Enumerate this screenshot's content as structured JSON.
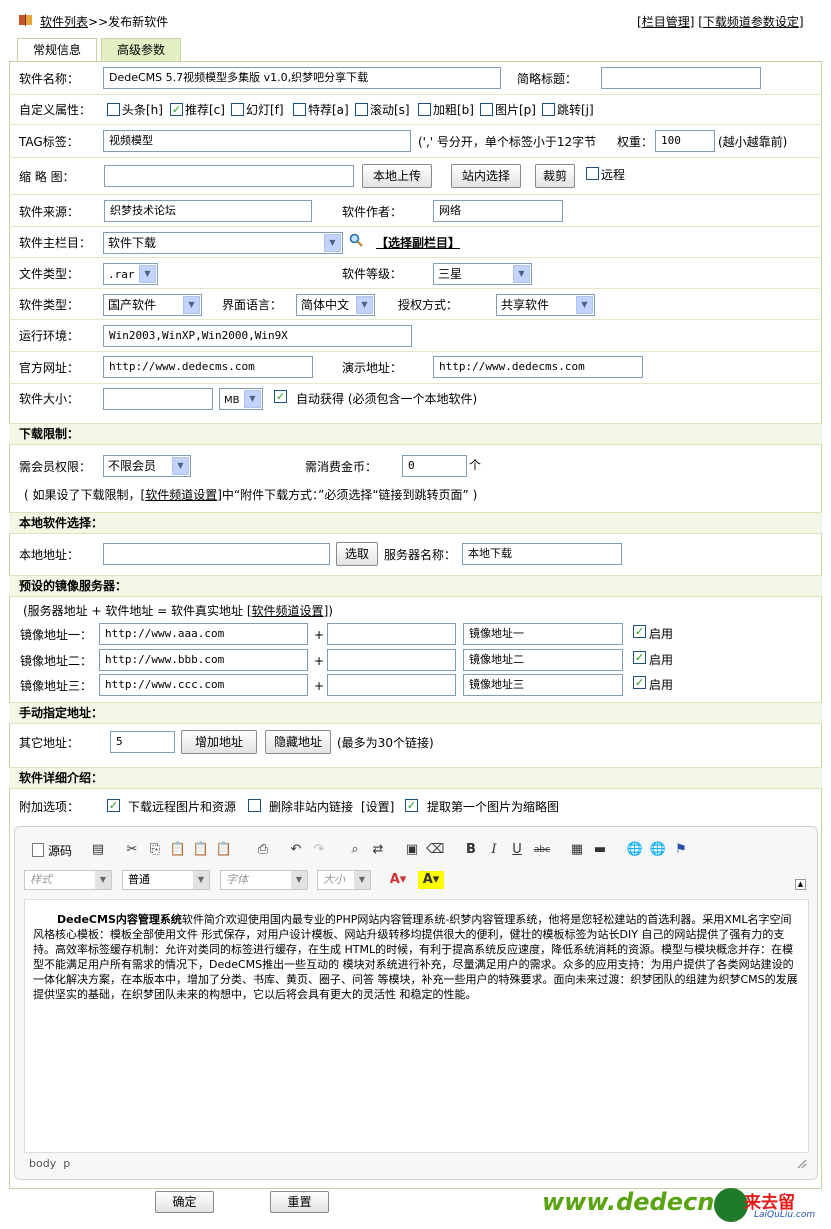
{
  "header": {
    "crumb_list": "软件列表",
    "crumb_sep": ">>",
    "crumb_current": "发布新软件",
    "link_column": "栏目管理",
    "link_params": "下载频道参数设定",
    "bracket_l": "[",
    "bracket_m": "] [",
    "bracket_r": "]"
  },
  "tabs": [
    {
      "label": "常规信息"
    },
    {
      "label": "高级参数"
    }
  ],
  "fields": {
    "title_label": "软件名称：",
    "title_value": "DedeCMS 5.7视频模型多集版 v1.0,织梦吧分享下载",
    "short_label": "简略标题：",
    "attr_label": "自定义属性：",
    "attrs": [
      {
        "label": "头条[h]",
        "checked": false
      },
      {
        "label": "推荐[c]",
        "checked": true
      },
      {
        "label": "幻灯[f]",
        "checked": false
      },
      {
        "label": "特荐[a]",
        "checked": false
      },
      {
        "label": "滚动[s]",
        "checked": false
      },
      {
        "label": "加粗[b]",
        "checked": false
      },
      {
        "label": "图片[p]",
        "checked": false
      },
      {
        "label": "跳转[j]",
        "checked": false
      }
    ],
    "tag_label": "TAG标签：",
    "tag_value": "视频模型",
    "tag_hint": "(',' 号分开，单个标签小于12字节",
    "weight_label": "权重：",
    "weight_value": "100",
    "weight_hint": "(越小越靠前)",
    "thumb_label": "缩 略 图：",
    "btn_upload": "本地上传",
    "btn_site": "站内选择",
    "btn_crop": "裁剪",
    "remote_label": "远程",
    "source_label": "软件来源：",
    "source_value": "织梦技术论坛",
    "author_label": "软件作者：",
    "author_value": "网络",
    "column_label": "软件主栏目：",
    "column_value": "软件下载",
    "sub_column": "【选择副栏目】",
    "filetype_label": "文件类型：",
    "filetype_value": ".rar",
    "level_label": "软件等级：",
    "level_value": "三星",
    "softtype_label": "软件类型：",
    "softtype_value": "国产软件",
    "lang_label": "界面语言：",
    "lang_value": "简体中文",
    "license_label": "授权方式：",
    "license_value": "共享软件",
    "env_label": "运行环境：",
    "env_value": "Win2003,WinXP,Win2000,Win9X",
    "site_label": "官方网址：",
    "site_value": "http://www.dedecms.com",
    "demo_label": "演示地址：",
    "demo_value": "http://www.dedecms.com",
    "size_label": "软件大小：",
    "size_unit": "MB",
    "auto_label": "自动获得 (必须包含一个本地软件)"
  },
  "download_limit": {
    "title": "下载限制：",
    "member_label": "需会员权限：",
    "member_value": "不限会员",
    "coins_label": "需消费金币：",
    "coins_value": "0",
    "coins_unit": "个",
    "note_a": "( 如果设了下载限制，[",
    "note_link": "软件频道设置",
    "note_b": "]中“附件下载方式：”必须选择“链接到跳转页面” )"
  },
  "local": {
    "title": "本地软件选择：",
    "addr_label": "本地地址：",
    "btn_select": "选取",
    "server_label": "服务器名称：",
    "server_value": "本地下载"
  },
  "mirror": {
    "title": "预设的镜像服务器：",
    "note_a": "(服务器地址 + 软件地址 = 软件真实地址 [",
    "note_link": "软件频道设置",
    "note_b": "])",
    "plus": "+",
    "enable": "启用",
    "rows": [
      {
        "label": "镜像地址一：",
        "url": "http://www.aaa.com",
        "name": "镜像地址一"
      },
      {
        "label": "镜像地址二：",
        "url": "http://www.bbb.com",
        "name": "镜像地址二"
      },
      {
        "label": "镜像地址三：",
        "url": "http://www.ccc.com",
        "name": "镜像地址三"
      }
    ]
  },
  "manual": {
    "title": "手动指定地址：",
    "other_label": "其它地址：",
    "other_value": "5",
    "btn_add": "增加地址",
    "btn_hide": "隐藏地址",
    "hint": "(最多为30个链接)"
  },
  "detail": {
    "title": "软件详细介绍：",
    "options_label": "附加选项：",
    "opt_remote": "下载远程图片和资源",
    "opt_del": "删除非站内链接",
    "opt_set": "[设置]",
    "opt_first": "提取第一个图片为缩略图"
  },
  "editor": {
    "source_label": "源码",
    "style_ph": "样式",
    "format_val": "普通",
    "font_ph": "字体",
    "size_ph": "大小",
    "body_lead": "DedeCMS内容管理系统",
    "body_text": "软件简介欢迎使用国内最专业的PHP网站内容管理系统-织梦内容管理系统，他将是您轻松建站的首选利器。采用XML名字空间风格核心模板：模板全部使用文件 形式保存，对用户设计模板、网站升级转移均提供很大的便利，健壮的模板标签为站长DIY 自己的网站提供了强有力的支持。高效率标签缓存机制：允许对类同的标签进行缓存，在生成 HTML的时候，有利于提高系统反应速度，降低系统消耗的资源。模型与模块概念并存：在模型不能满足用户所有需求的情况下，DedeCMS推出一些互动的 模块对系统进行补充，尽量满足用户的需求。众多的应用支持：为用户提供了各类网站建设的一体化解决方案，在本版本中，增加了分类、书库、黄页、圈子、问答 等模块，补充一些用户的特殊要求。面向未来过渡：织梦团队的组建为织梦CMS的发展提供坚实的基础，在织梦团队未来的构想中，它以后将会具有更大的灵活性 和稳定的性能。",
    "path": "body  p"
  },
  "footer": {
    "ok": "确定",
    "reset": "重置",
    "brand": "www.dedecn",
    "stamp": "来去留",
    "stamp_sub": "LaiQuLiu.com"
  },
  "colors": {
    "section_bg": "#f5f7e6",
    "tab_active": "#e2f0c3",
    "link": "#000",
    "brand": "#5aa414"
  }
}
